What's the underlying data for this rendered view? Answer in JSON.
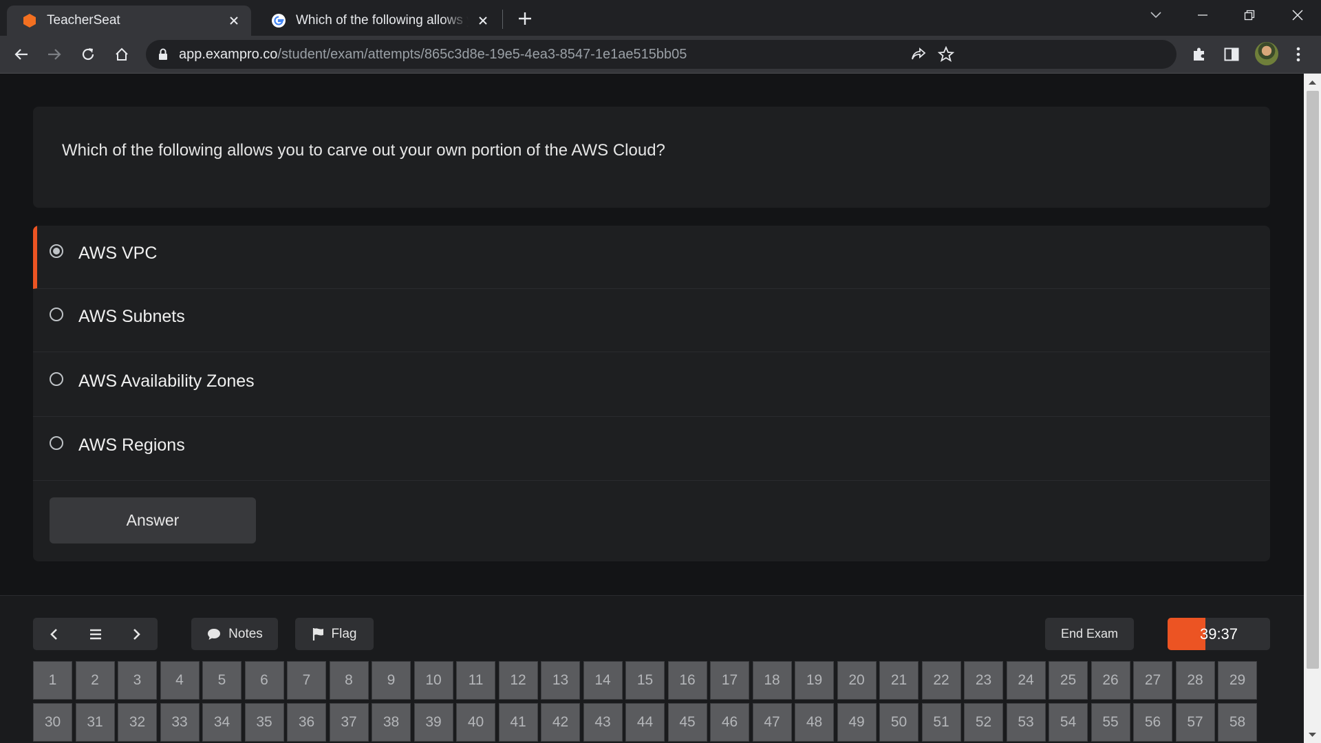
{
  "browser": {
    "tabs": [
      {
        "title": "TeacherSeat",
        "active": true,
        "favicon": "hexagon-icon",
        "favicon_color": "#f37021"
      },
      {
        "title": "Which of the following allows you to carve out your own portion",
        "active": false,
        "favicon": "google-icon"
      }
    ],
    "url_host": "app.exampro.co",
    "url_path": "/student/exam/attempts/865c3d8e-19e5-4ea3-8547-1e1ae515bb05"
  },
  "exam": {
    "question": "Which of the following allows you to carve out your own portion of the AWS Cloud?",
    "options": [
      {
        "label": "AWS VPC",
        "selected": true
      },
      {
        "label": "AWS Subnets",
        "selected": false
      },
      {
        "label": "AWS Availability Zones",
        "selected": false
      },
      {
        "label": "AWS Regions",
        "selected": false
      }
    ],
    "answer_label": "Answer"
  },
  "footer": {
    "notes_label": "Notes",
    "flag_label": "Flag",
    "end_exam_label": "End Exam",
    "timer": "39:37",
    "timer_remaining_fraction": 0.37,
    "accent_color": "#ec5423",
    "question_numbers": [
      "1",
      "2",
      "3",
      "4",
      "5",
      "6",
      "7",
      "8",
      "9",
      "10",
      "11",
      "12",
      "13",
      "14",
      "15",
      "16",
      "17",
      "18",
      "19",
      "20",
      "21",
      "22",
      "23",
      "24",
      "25",
      "26",
      "27",
      "28",
      "29",
      "30",
      "31",
      "32",
      "33",
      "34",
      "35",
      "36",
      "37",
      "38",
      "39",
      "40",
      "41",
      "42",
      "43",
      "44",
      "45",
      "46",
      "47",
      "48",
      "49",
      "50",
      "51",
      "52",
      "53",
      "54",
      "55",
      "56",
      "57",
      "58"
    ]
  }
}
